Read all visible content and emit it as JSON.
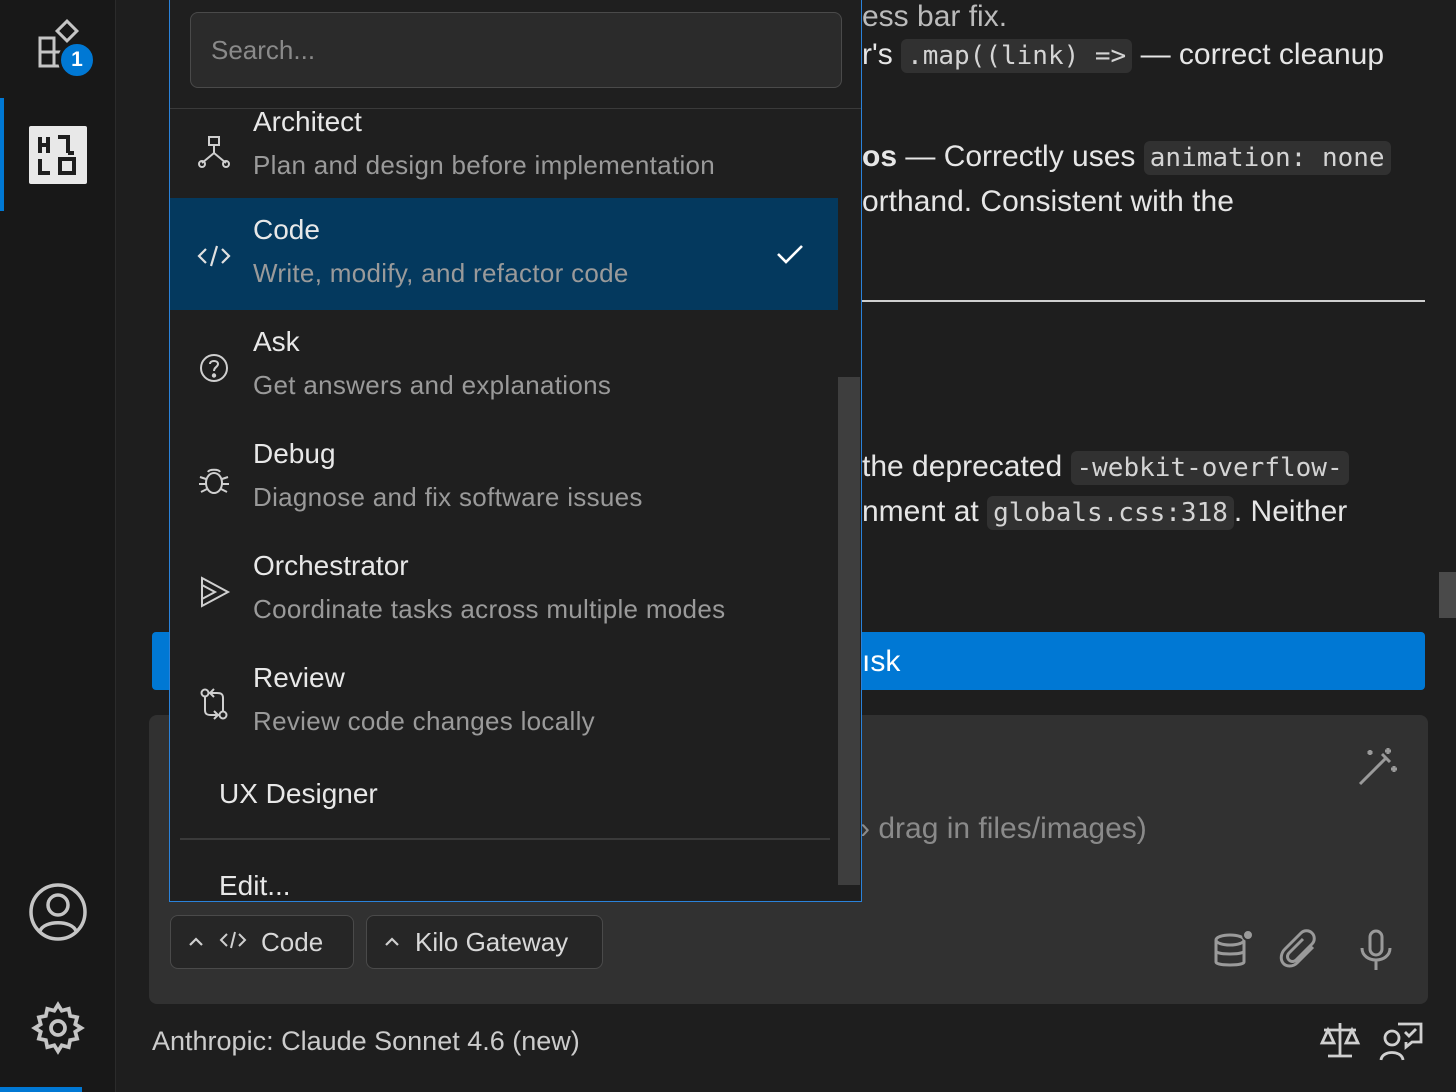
{
  "activity_bar": {
    "extensions_badge": "1",
    "icons": [
      "extensions-icon",
      "kilo-logo-icon",
      "account-icon",
      "settings-gear-icon"
    ]
  },
  "chat": {
    "frag1_pre": "r's",
    "frag1_code": ".map((link) =>",
    "frag1_post": "— correct cleanup",
    "frag2_bold": "os",
    "frag2_text": "— Correctly uses",
    "frag2_code": "animation: none",
    "frag3_text": "orthand. Consistent with the",
    "frag4_text": "the deprecated",
    "frag4_code": "-webkit-overflow-",
    "frag5_text": "nment at",
    "frag5_code": "globals.css:318",
    "frag5_post": ". Neither",
    "new_task_fragment": "ısk",
    "input_placeholder_fragment": "drag in files/images)",
    "model_name": "Anthropic: Claude Sonnet 4.6 (new)"
  },
  "controls": {
    "mode_pill": "Code",
    "provider_pill": "Kilo Gateway"
  },
  "dropdown": {
    "search_placeholder": "Search...",
    "selected_mode": "Code",
    "modes": [
      {
        "name": "Architect",
        "description": "Plan and design before implementation",
        "icon": "architect-icon"
      },
      {
        "name": "Code",
        "description": "Write, modify, and refactor code",
        "icon": "code-icon"
      },
      {
        "name": "Ask",
        "description": "Get answers and explanations",
        "icon": "question-icon"
      },
      {
        "name": "Debug",
        "description": "Diagnose and fix software issues",
        "icon": "bug-icon"
      },
      {
        "name": "Orchestrator",
        "description": "Coordinate tasks across multiple modes",
        "icon": "orchestrator-icon"
      },
      {
        "name": "Review",
        "description": "Review code changes locally",
        "icon": "git-compare-icon"
      }
    ],
    "extra_mode": "UX Designer",
    "edit_label": "Edit..."
  },
  "colors": {
    "accent": "#0078d4",
    "selected_bg": "#04395e",
    "background": "#1e1e1e"
  }
}
